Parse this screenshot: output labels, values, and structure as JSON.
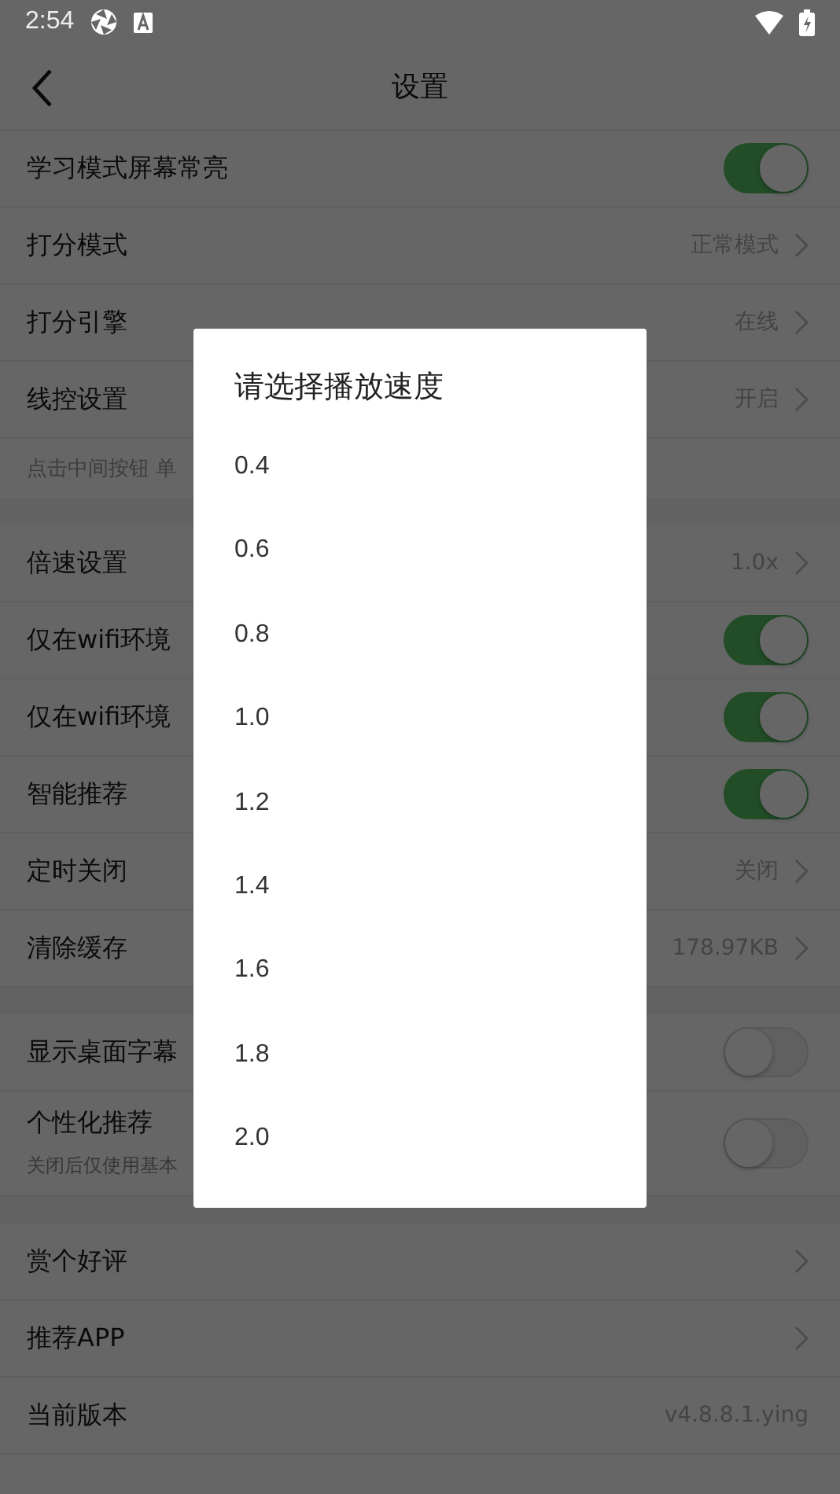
{
  "status_bar": {
    "time": "2:54"
  },
  "header": {
    "title": "设置"
  },
  "settings": [
    {
      "kind": "toggle",
      "label": "学习模式屏幕常亮",
      "on": true
    },
    {
      "kind": "link",
      "label": "打分模式",
      "value": "正常模式"
    },
    {
      "kind": "link",
      "label": "打分引擎",
      "value": "在线"
    },
    {
      "kind": "link",
      "label": "线控设置",
      "value": "开启"
    },
    {
      "kind": "hint",
      "label": "点击中间按钮 单"
    },
    {
      "kind": "gap"
    },
    {
      "kind": "link",
      "label": "倍速设置",
      "value": "1.0x"
    },
    {
      "kind": "toggle",
      "label": "仅在wifi环境",
      "on": true
    },
    {
      "kind": "toggle",
      "label": "仅在wifi环境",
      "on": true
    },
    {
      "kind": "toggle",
      "label": "智能推荐",
      "on": true
    },
    {
      "kind": "link",
      "label": "定时关闭",
      "value": "关闭"
    },
    {
      "kind": "link",
      "label": "清除缓存",
      "value": "178.97KB"
    },
    {
      "kind": "gap"
    },
    {
      "kind": "toggle",
      "label": "显示桌面字幕",
      "on": false
    },
    {
      "kind": "toggle",
      "label": "个性化推荐",
      "note": "关闭后仅使用基本",
      "on": false
    },
    {
      "kind": "gap"
    },
    {
      "kind": "link",
      "label": "赏个好评"
    },
    {
      "kind": "link",
      "label": "推荐APP"
    },
    {
      "kind": "link",
      "label": "当前版本",
      "value": "v4.8.8.1.ying",
      "arrow": false
    }
  ],
  "dialog": {
    "title": "请选择播放速度",
    "options": [
      "0.4",
      "0.6",
      "0.8",
      "1.0",
      "1.2",
      "1.4",
      "1.6",
      "1.8",
      "2.0"
    ]
  }
}
